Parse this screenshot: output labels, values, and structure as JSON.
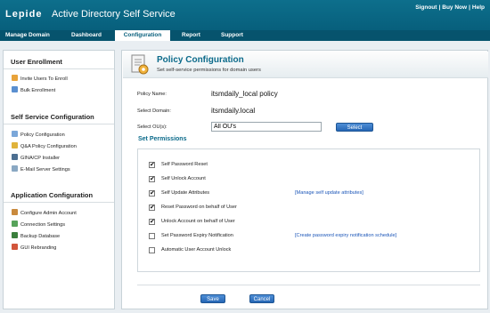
{
  "header": {
    "logo": "Lepide",
    "title": "Active Directory Self Service",
    "links": [
      "Signout",
      "Buy Now",
      "Help"
    ]
  },
  "nav": [
    "Manage Domain",
    "Dashboard",
    "Configuration",
    "Report",
    "Support"
  ],
  "nav_active": "Configuration",
  "sidebar": {
    "sections": [
      {
        "title": "User Enrollment",
        "items": [
          {
            "label": "Invite Users To Enroll",
            "icon": "invite-icon"
          },
          {
            "label": "Bulk Enrollment",
            "icon": "bulk-enroll-icon"
          }
        ]
      },
      {
        "title": "Self Service Configuration",
        "items": [
          {
            "label": "Policy Configuration",
            "icon": "policy-icon"
          },
          {
            "label": "Q&A Policy Configuration",
            "icon": "qa-icon"
          },
          {
            "label": "GINA/CP Installer",
            "icon": "installer-icon"
          },
          {
            "label": "E-Mail Server Settings",
            "icon": "email-icon"
          }
        ]
      },
      {
        "title": "Application Configuration",
        "items": [
          {
            "label": "Configure Admin Account",
            "icon": "admin-icon"
          },
          {
            "label": "Connection Settings",
            "icon": "connection-icon"
          },
          {
            "label": "Backup Database",
            "icon": "database-icon"
          },
          {
            "label": "GUI Rebranding",
            "icon": "rebrand-icon"
          }
        ]
      }
    ]
  },
  "page": {
    "title": "Policy Configuration",
    "subtitle": "Set self-service permissions for domain users"
  },
  "form": {
    "policy_name_label": "Policy Name:",
    "policy_name_value": "itsmdaily_local policy",
    "domain_label": "Select Domain:",
    "domain_value": "itsmdaily.local",
    "ou_label": "Select OU(s):",
    "ou_value": "All OU's",
    "select_button": "Select"
  },
  "permissions": {
    "heading": "Set Permissions",
    "items": [
      {
        "label": "Self Password Reset",
        "checked": true,
        "link": ""
      },
      {
        "label": "Self Unlock Account",
        "checked": true,
        "link": ""
      },
      {
        "label": "Self Update Attributes",
        "checked": true,
        "link": "[Manage self update attributes]"
      },
      {
        "label": "Reset Password on behalf of User",
        "checked": true,
        "link": ""
      },
      {
        "label": "Unlock Account on behalf of User",
        "checked": true,
        "link": ""
      },
      {
        "label": "Set Password Expiry Notification",
        "checked": false,
        "link": "[Create password expiry notification schedule]"
      },
      {
        "label": "Automatic User Account Unlock",
        "checked": false,
        "link": ""
      }
    ]
  },
  "actions": {
    "save": "Save",
    "cancel": "Cancel"
  },
  "colors": {
    "header": "#0d6f8c",
    "nav": "#06536d",
    "accent": "#0b6a8a",
    "button": "#2667b5",
    "link": "#1a55b8"
  }
}
